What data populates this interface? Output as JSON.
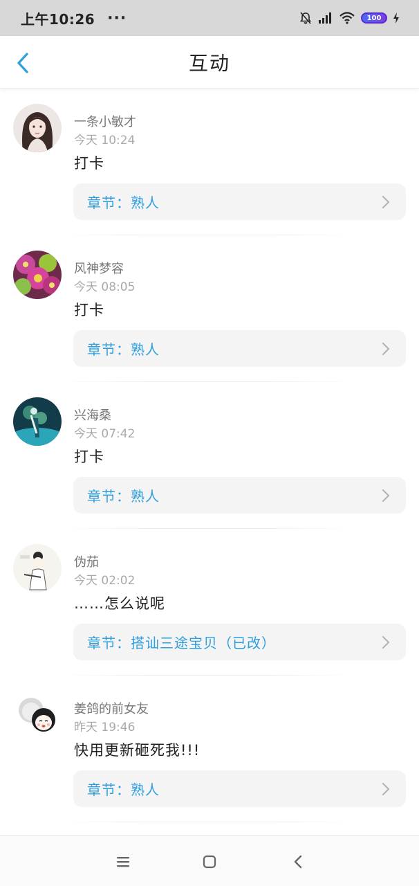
{
  "status_bar": {
    "time": "上午10:26",
    "dots": "···",
    "battery": "100",
    "icons": [
      "bell-off-icon",
      "signal-icon",
      "wifi-icon",
      "battery-icon",
      "charging-icon"
    ]
  },
  "header": {
    "title": "互动",
    "back_icon": "chevron-left-icon",
    "accent_color": "#2e9fde"
  },
  "items": [
    {
      "username": "一条小敏才",
      "time": "今天 10:24",
      "comment": "打卡",
      "chapter": "章节：熟人"
    },
    {
      "username": "风神梦容",
      "time": "今天 08:05",
      "comment": "打卡",
      "chapter": "章节：熟人"
    },
    {
      "username": "兴海桑",
      "time": "今天 07:42",
      "comment": "打卡",
      "chapter": "章节：熟人"
    },
    {
      "username": "伪茄",
      "time": "今天 02:02",
      "comment": "……怎么说呢",
      "chapter": "章节：搭讪三途宝贝（已改）"
    },
    {
      "username": "姜鸽的前女友",
      "time": "昨天 19:46",
      "comment": "快用更新砸死我!!!",
      "chapter": "章节：熟人"
    }
  ],
  "bottom_nav": {
    "icons": [
      "menu-icon",
      "home-icon",
      "back-icon"
    ]
  }
}
